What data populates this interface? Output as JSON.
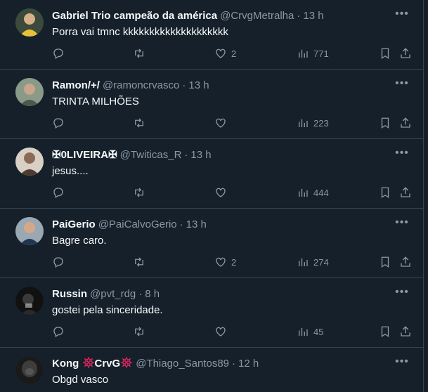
{
  "tweets": [
    {
      "name": "Gabriel Trio campeão da américa",
      "handle": "@CrvgMetralha",
      "time": "13 h",
      "text": "Porra vai tmnc kkkkkkkkkkkkkkkkkkkk",
      "replies": "",
      "retweets": "",
      "likes": "2",
      "views": "771",
      "avatar_color": "#c9a227"
    },
    {
      "name": "Ramon/+/",
      "handle": "@ramoncrvasco",
      "time": "13 h",
      "text": "TRINTA MILHÕES",
      "replies": "",
      "retweets": "",
      "likes": "",
      "views": "223",
      "avatar_color": "#6b7b6a"
    },
    {
      "name": "✠0LIVEIRA✠",
      "handle": "@Twiticas_R",
      "time": "13 h",
      "text": "jesus....",
      "replies": "",
      "retweets": "",
      "likes": "",
      "views": "444",
      "avatar_color": "#8b6a55"
    },
    {
      "name": "PaiGerio",
      "handle": "@PaiCalvoGerio",
      "time": "13 h",
      "text": "Bagre caro.",
      "replies": "",
      "retweets": "",
      "likes": "2",
      "views": "274",
      "avatar_color": "#2f4f6f"
    },
    {
      "name": "Russin",
      "handle": "@pvt_rdg",
      "time": "8 h",
      "text": "gostei pela sinceridade.",
      "replies": "",
      "retweets": "",
      "likes": "",
      "views": "45",
      "avatar_color": "#1e1e1e"
    },
    {
      "name_parts": [
        "Kong ",
        "CrvG"
      ],
      "handle": "@Thiago_Santos89",
      "time": "12 h",
      "text": "Obgd vasco",
      "avatar_color": "#222222"
    }
  ],
  "colors": {
    "background": "#15202b",
    "muted": "#8b98a5",
    "border": "#38444d",
    "text": "#f7f9f9",
    "badge": "#e0245e"
  },
  "icons": [
    "reply-icon",
    "retweet-icon",
    "like-icon",
    "views-icon",
    "bookmark-icon",
    "share-icon",
    "more-icon",
    "badge-icon"
  ]
}
